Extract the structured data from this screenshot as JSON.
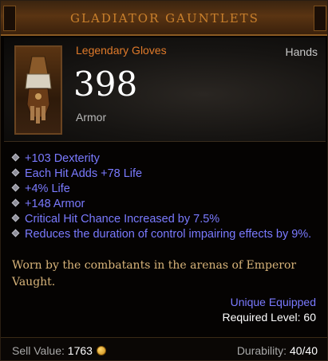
{
  "item": {
    "name": "GLADIATOR GAUNTLETS",
    "type": "Legendary Gloves",
    "slot": "Hands",
    "armor_value": "398",
    "armor_label": "Armor",
    "icon": "gauntlet-icon"
  },
  "affixes": [
    "+103 Dexterity",
    "Each Hit Adds +78 Life",
    "+4% Life",
    "+148 Armor",
    "Critical Hit Chance Increased by 7.5%",
    "Reduces the duration of control impairing effects by 9%."
  ],
  "flavor": "Worn by the combatants in the arenas of Emperor Vaught.",
  "status": {
    "unique": "Unique Equipped",
    "required": "Required Level: 60"
  },
  "footer": {
    "sell_label": "Sell Value:",
    "sell_value": "1763",
    "durability_label": "Durability:",
    "durability_value": "40/40"
  },
  "colors": {
    "title": "#c9802c",
    "legendary": "#e07a2a",
    "affix": "#7a7aff",
    "flavor": "#d8b47a"
  }
}
